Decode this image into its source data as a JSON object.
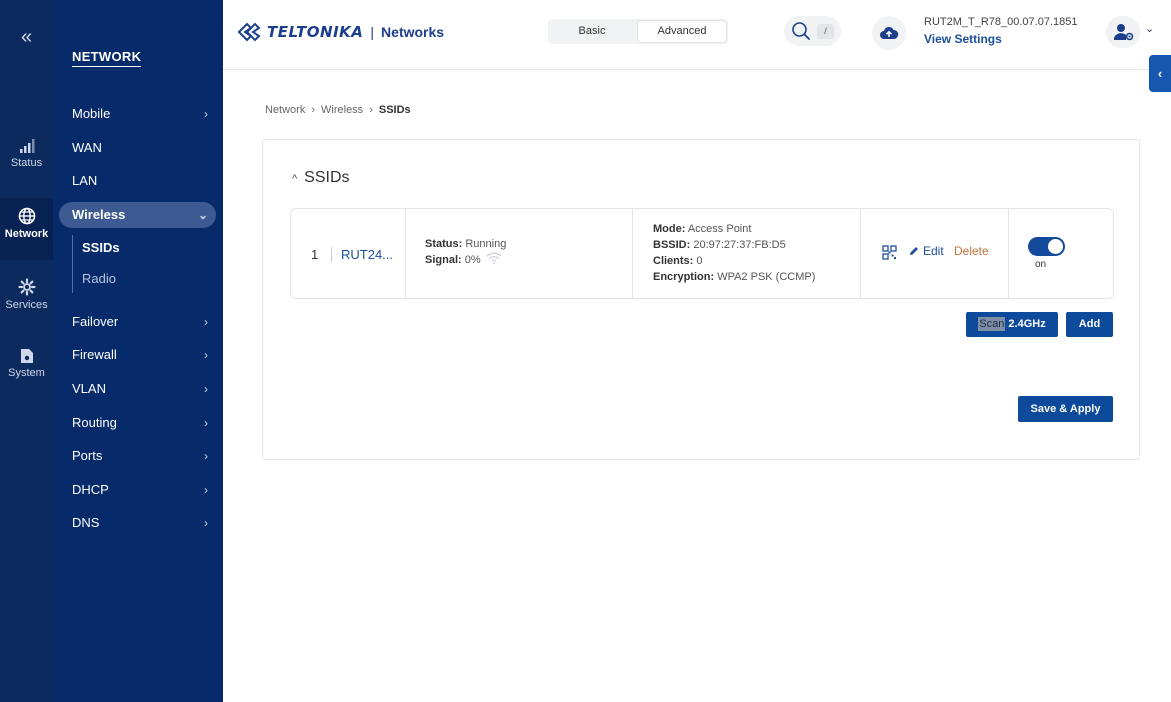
{
  "rail": {
    "collapse_label": "«",
    "items": [
      {
        "label": "Status",
        "icon": "signal-bars-icon"
      },
      {
        "label": "Network",
        "icon": "globe-icon"
      },
      {
        "label": "Services",
        "icon": "gear-icon"
      },
      {
        "label": "System",
        "icon": "system-icon"
      }
    ]
  },
  "nav": {
    "title": "NETWORK",
    "items": [
      {
        "label": "Mobile",
        "chevron": "›"
      },
      {
        "label": "WAN"
      },
      {
        "label": "LAN"
      },
      {
        "label": "Wireless",
        "chevron": "⌄"
      },
      {
        "label": "Failover",
        "chevron": "›"
      },
      {
        "label": "Firewall",
        "chevron": "›"
      },
      {
        "label": "VLAN",
        "chevron": "›"
      },
      {
        "label": "Routing",
        "chevron": "›"
      },
      {
        "label": "Ports",
        "chevron": "›"
      },
      {
        "label": "DHCP",
        "chevron": "›"
      },
      {
        "label": "DNS",
        "chevron": "›"
      }
    ],
    "wireless_sub": [
      {
        "label": "SSIDs"
      },
      {
        "label": "Radio"
      }
    ]
  },
  "header": {
    "brand": "TELTONIKA",
    "separator": "|",
    "product": "Networks",
    "modes": {
      "basic": "Basic",
      "advanced": "Advanced"
    },
    "search_shortcut": "/",
    "device_name": "RUT2M_T_R78_00.07.07.1851",
    "view_settings": "View Settings",
    "user_chevron": "⌄",
    "side_tab": "‹"
  },
  "breadcrumb": {
    "items": [
      "Network",
      "Wireless",
      "SSIDs"
    ],
    "separator": "›"
  },
  "panel": {
    "title": "SSIDs",
    "caret": "^",
    "row": {
      "index": "1",
      "ssid": "RUT24...",
      "status_label": "Status:",
      "status_value": "Running",
      "signal_label": "Signal:",
      "signal_value": "0%",
      "mode_label": "Mode:",
      "mode_value": "Access Point",
      "bssid_label": "BSSID:",
      "bssid_value": "20:97:27:37:FB:D5",
      "clients_label": "Clients:",
      "clients_value": "0",
      "encryption_label": "Encryption:",
      "encryption_value": "WPA2 PSK (CCMP)",
      "edit_label": "Edit",
      "delete_label": "Delete",
      "toggle_state": "on"
    },
    "buttons": {
      "scan_prefix": "Scan",
      "scan_suffix": " 2.4GHz",
      "add": "Add",
      "save_apply": "Save & Apply"
    }
  },
  "colors": {
    "rail_bg": "#0c2a5e",
    "nav_bg": "#062a6a",
    "accent": "#0d4a9c",
    "link": "#1c4f9c",
    "delete": "#c4733a"
  }
}
